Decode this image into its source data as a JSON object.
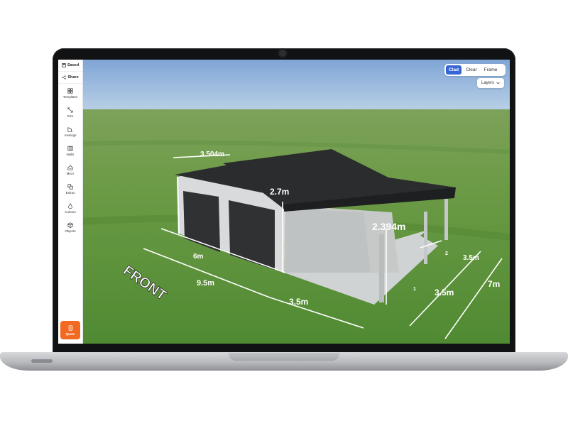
{
  "sidebar": {
    "saved_label": "Saved",
    "share_label": "Share",
    "items": [
      {
        "label": "Templates",
        "icon": "grid-icon"
      },
      {
        "label": "Size",
        "icon": "resize-icon"
      },
      {
        "label": "Awnings",
        "icon": "awning-icon"
      },
      {
        "label": "Walls",
        "icon": "walls-icon"
      },
      {
        "label": "Mezz",
        "icon": "mezzanine-icon"
      },
      {
        "label": "Extras",
        "icon": "extras-icon"
      },
      {
        "label": "Colours",
        "icon": "droplet-icon"
      },
      {
        "label": "Objects",
        "icon": "cube-icon"
      }
    ],
    "quote_label": "Quote"
  },
  "view_modes": {
    "options": [
      "Clad",
      "Clear",
      "Frame"
    ],
    "selected": "Clad"
  },
  "layers_label": "Layers",
  "scene": {
    "front_label": "FRONT",
    "dimensions": {
      "roof_pitch_width": "3.504m",
      "wall_height": "2.7m",
      "awning_height": "2.394m",
      "shed_width": "6m",
      "total_width": "9.5m",
      "awning_width": "3.5m",
      "bay_depth_a": "3.5m",
      "bay_depth_b": "3.5m",
      "total_depth": "7m"
    },
    "bay_numbers": [
      "1",
      "2"
    ]
  },
  "colors": {
    "accent": "#3566d6",
    "quote": "#f26a21",
    "roof": "#2b2c2e",
    "wall": "#d8d9da",
    "grass": "#5f8f3c",
    "sky": "#86a9d6"
  }
}
